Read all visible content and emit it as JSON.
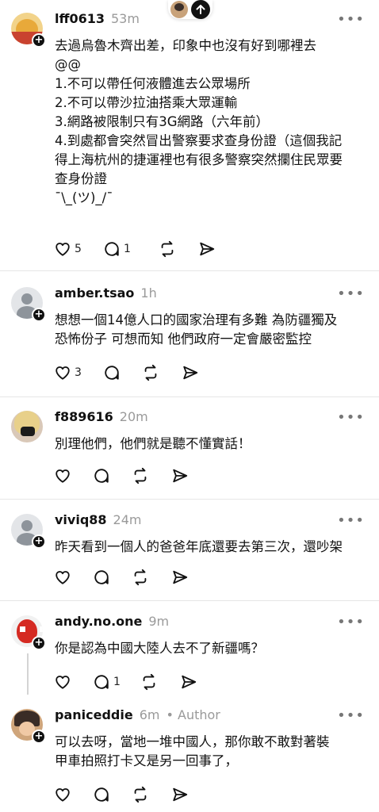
{
  "comments": [
    {
      "username": "lff0613",
      "time": "53m",
      "avatar_icon": "winnie-pooh-avatar-icon",
      "lines": [
        "去過烏魯木齊出差，印象中也沒有好到哪裡去",
        "@@",
        "1.不可以帶任何液體進去公眾場所",
        "2.不可以帶沙拉油搭乘大眾運輸",
        "3.網路被限制只有3G網路（六年前）",
        "4.到處都會突然冒出警察要求查身份證（這個我記",
        "得上海杭州的捷運裡也有很多警察突然攔住民眾要",
        "查身份證",
        "¯\\_(ツ)_/¯"
      ],
      "likes": "5",
      "replies": "1"
    },
    {
      "username": "amber.tsao",
      "time": "1h",
      "avatar_icon": "default-user-avatar-icon",
      "lines": [
        "想想一個14億人口的國家治理有多難  為防疆獨及",
        "恐怖份子  可想而知  他們政府一定會嚴密監控"
      ],
      "likes": "3",
      "replies": ""
    },
    {
      "username": "f889616",
      "time": "20m",
      "avatar_icon": "masked-person-avatar-icon",
      "lines": [
        "別理他們，他們就是聽不懂實話！"
      ],
      "likes": "",
      "replies": ""
    },
    {
      "username": "viviq88",
      "time": "24m",
      "avatar_icon": "default-user-avatar-icon",
      "lines": [
        "昨天看到一個人的爸爸年底還要去第三次，還吵架"
      ],
      "likes": "",
      "replies": ""
    },
    {
      "username": "andy.no.one",
      "time": "9m",
      "avatar_icon": "spiderman-avatar-icon",
      "lines": [
        "你是認為中國大陸人去不了新疆嗎？"
      ],
      "likes": "",
      "replies": "1"
    },
    {
      "username": "paniceddie",
      "time": "6m",
      "author_tag": "• Author",
      "avatar_icon": "author-avatar-icon",
      "lines": [
        "可以去呀，當地一堆中國人，那你敢不敢對著裝",
        "甲車拍照打卡又是另一回事了，"
      ],
      "likes": "",
      "replies": ""
    }
  ],
  "more_label": "•••",
  "colors": {
    "text": "#111111",
    "muted": "#9a9a9a",
    "divider": "#e6e6e6"
  }
}
